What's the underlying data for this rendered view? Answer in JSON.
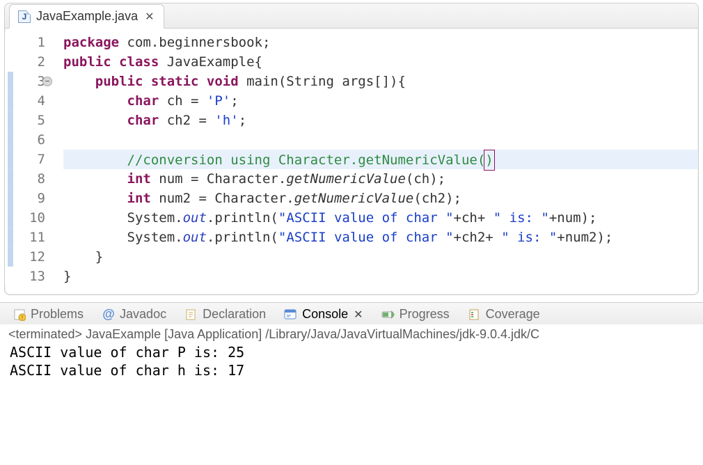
{
  "editor": {
    "tab": {
      "icon_letter": "J",
      "filename": "JavaExample.java"
    },
    "fold_line": 3,
    "highlight_line": 7,
    "caret_tail": ")",
    "marker_lines": [
      3,
      4,
      5,
      6,
      7,
      8,
      9,
      10,
      11,
      12
    ],
    "lines": [
      {
        "n": 1,
        "segs": [
          {
            "t": "package ",
            "c": "kw"
          },
          {
            "t": "com.beginnersbook;",
            "c": "pkg"
          }
        ]
      },
      {
        "n": 2,
        "segs": [
          {
            "t": "public class ",
            "c": "kw"
          },
          {
            "t": "JavaExample{",
            "c": "pkg"
          }
        ]
      },
      {
        "n": 3,
        "segs": [
          {
            "t": "    ",
            "c": ""
          },
          {
            "t": "public static void ",
            "c": "kw"
          },
          {
            "t": "main(String args[]){",
            "c": "pkg"
          }
        ]
      },
      {
        "n": 4,
        "segs": [
          {
            "t": "        ",
            "c": ""
          },
          {
            "t": "char ",
            "c": "kw"
          },
          {
            "t": "ch = ",
            "c": "pkg"
          },
          {
            "t": "'P'",
            "c": "chr"
          },
          {
            "t": ";",
            "c": "pkg"
          }
        ]
      },
      {
        "n": 5,
        "segs": [
          {
            "t": "        ",
            "c": ""
          },
          {
            "t": "char ",
            "c": "kw"
          },
          {
            "t": "ch2 = ",
            "c": "pkg"
          },
          {
            "t": "'h'",
            "c": "chr"
          },
          {
            "t": ";",
            "c": "pkg"
          }
        ]
      },
      {
        "n": 6,
        "segs": []
      },
      {
        "n": 7,
        "segs": [
          {
            "t": "        ",
            "c": ""
          },
          {
            "t": "//conversion using Character.getNumericValue(",
            "c": "cmt"
          }
        ]
      },
      {
        "n": 8,
        "segs": [
          {
            "t": "        ",
            "c": ""
          },
          {
            "t": "int ",
            "c": "kw"
          },
          {
            "t": "num = Character.",
            "c": "pkg"
          },
          {
            "t": "getNumericValue",
            "c": "mthdItalic"
          },
          {
            "t": "(ch);",
            "c": "pkg"
          }
        ]
      },
      {
        "n": 9,
        "segs": [
          {
            "t": "        ",
            "c": ""
          },
          {
            "t": "int ",
            "c": "kw"
          },
          {
            "t": "num2 = Character.",
            "c": "pkg"
          },
          {
            "t": "getNumericValue",
            "c": "mthdItalic"
          },
          {
            "t": "(ch2);",
            "c": "pkg"
          }
        ]
      },
      {
        "n": 10,
        "segs": [
          {
            "t": "        System.",
            "c": "pkg"
          },
          {
            "t": "out",
            "c": "fieldItalic"
          },
          {
            "t": ".println(",
            "c": "pkg"
          },
          {
            "t": "\"ASCII value of char \"",
            "c": "str"
          },
          {
            "t": "+ch+ ",
            "c": "pkg"
          },
          {
            "t": "\" is: \"",
            "c": "str"
          },
          {
            "t": "+num);",
            "c": "pkg"
          }
        ]
      },
      {
        "n": 11,
        "segs": [
          {
            "t": "        System.",
            "c": "pkg"
          },
          {
            "t": "out",
            "c": "fieldItalic"
          },
          {
            "t": ".println(",
            "c": "pkg"
          },
          {
            "t": "\"ASCII value of char \"",
            "c": "str"
          },
          {
            "t": "+ch2+ ",
            "c": "pkg"
          },
          {
            "t": "\" is: \"",
            "c": "str"
          },
          {
            "t": "+num2);",
            "c": "pkg"
          }
        ]
      },
      {
        "n": 12,
        "segs": [
          {
            "t": "    }",
            "c": "pkg"
          }
        ]
      },
      {
        "n": 13,
        "segs": [
          {
            "t": "}",
            "c": "pkg"
          }
        ]
      }
    ]
  },
  "bottomTabs": {
    "problems": "Problems",
    "javadoc": "Javadoc",
    "declaration": "Declaration",
    "console": "Console",
    "progress": "Progress",
    "coverage": "Coverage"
  },
  "console": {
    "status": "<terminated> JavaExample [Java Application] /Library/Java/JavaVirtualMachines/jdk-9.0.4.jdk/C",
    "output": "ASCII value of char P is: 25\nASCII value of char h is: 17"
  }
}
